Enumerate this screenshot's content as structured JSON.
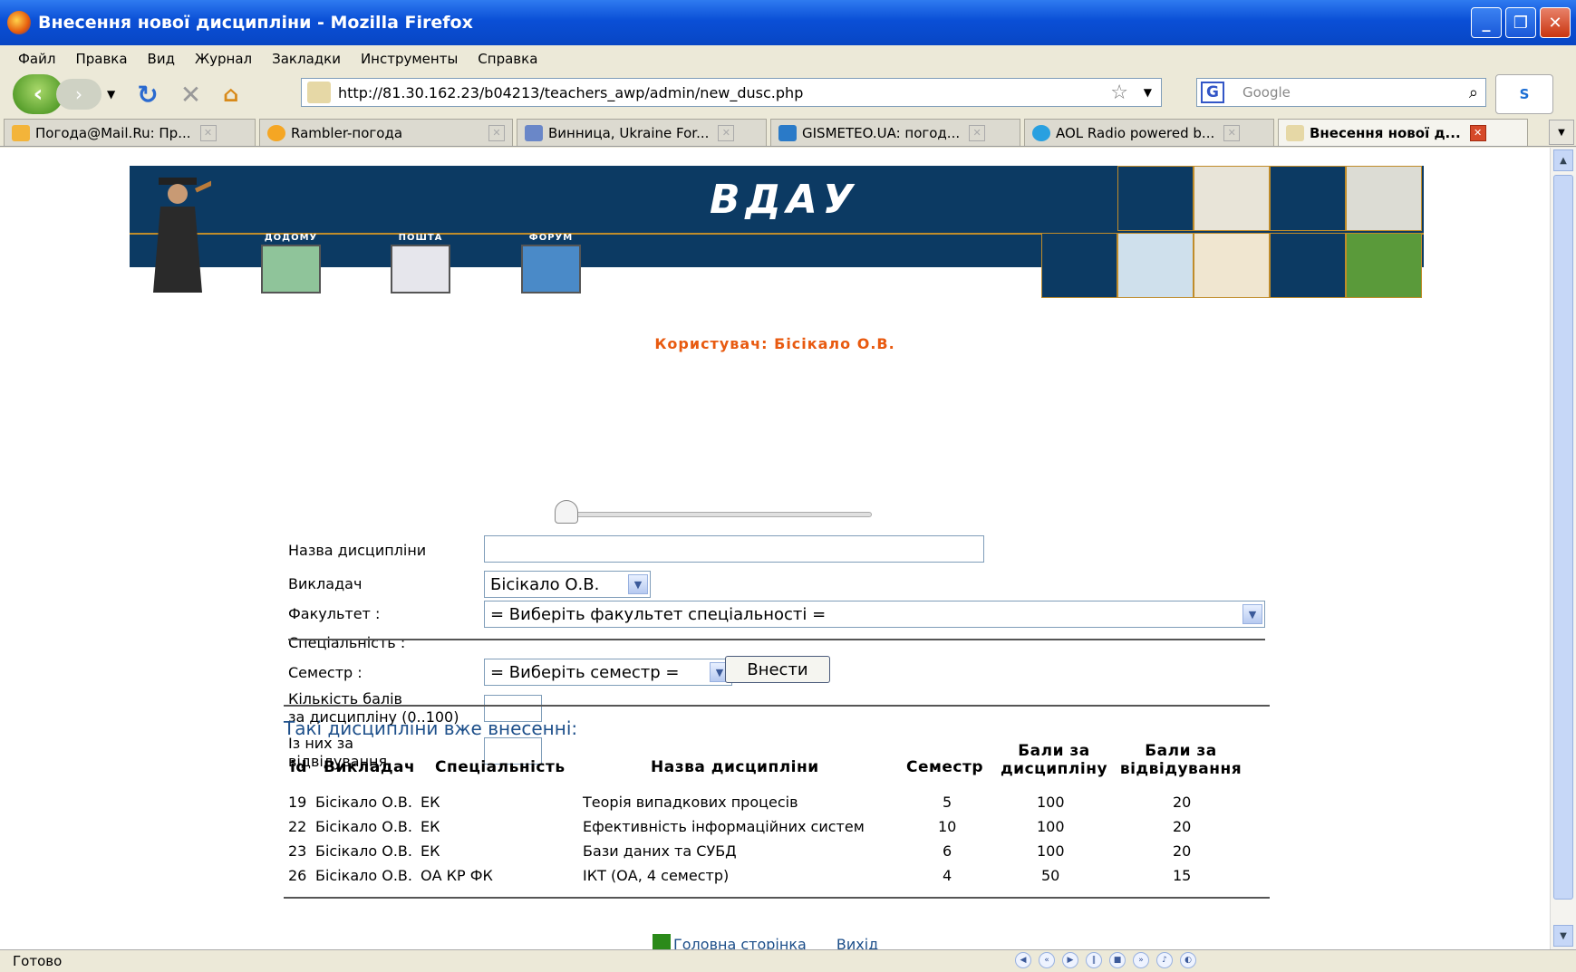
{
  "window": {
    "title": "Внесення нової дисципліни - Mozilla Firefox"
  },
  "menu": [
    "Файл",
    "Правка",
    "Вид",
    "Журнал",
    "Закладки",
    "Инструменты",
    "Справка"
  ],
  "nav": {
    "url": "http://81.30.162.23/b04213/teachers_awp/admin/new_dusc.php",
    "search_placeholder": "Google"
  },
  "tabs": [
    {
      "label": "Погода@Mail.Ru: Пр...",
      "active": false
    },
    {
      "label": "Rambler-погода",
      "active": false
    },
    {
      "label": "Винница, Ukraine For...",
      "active": false
    },
    {
      "label": "GISMETEO.UA: погод...",
      "active": false
    },
    {
      "label": "AOL Radio powered b...",
      "active": false
    },
    {
      "label": "Внесення нової д...",
      "active": true
    }
  ],
  "banner": {
    "brand": "ВДАУ",
    "nav": [
      "ДОДОМУ",
      "ПОШТА",
      "ФОРУМ"
    ]
  },
  "user_line": "Користувач: Бісікало О.В.",
  "form": {
    "labels": {
      "name": "Назва дисципліни",
      "teacher": "Викладач",
      "faculty": "Факультет :",
      "specialty": "Спеціальність :",
      "semester": "Семестр :",
      "points_line1": "Кількість балів",
      "points_line2": "за дисципліну (0..100)",
      "attendance_line1": "Із них за",
      "attendance_line2": "відвідування"
    },
    "values": {
      "name": "",
      "teacher": "Бісікало О.В.",
      "faculty": "= Виберіть факультет спеціальності =",
      "semester": "= Виберіть семестр =",
      "points": "",
      "attendance": ""
    },
    "slider_level": 0,
    "submit": "Внести"
  },
  "table": {
    "title": "Такі дисципліни вже внесенні:",
    "headers": {
      "id": "id",
      "teacher": "Викладач",
      "specialty": "Спеціальність",
      "name": "Назва дисципліни",
      "semester": "Семестр",
      "points_1": "Бали за",
      "points_2": "дисципліну",
      "attendance_1": "Бали за",
      "attendance_2": "відвідування"
    },
    "rows": [
      {
        "id": "19",
        "teacher": "Бісікало О.В.",
        "specialty": "ЕК",
        "name": "Теорія випадкових процесів",
        "semester": "5",
        "points": "100",
        "attendance": "20"
      },
      {
        "id": "22",
        "teacher": "Бісікало О.В.",
        "specialty": "ЕК",
        "name": "Ефективність інформаційних систем",
        "semester": "10",
        "points": "100",
        "attendance": "20"
      },
      {
        "id": "23",
        "teacher": "Бісікало О.В.",
        "specialty": "ЕК",
        "name": "Бази даних та СУБД",
        "semester": "6",
        "points": "100",
        "attendance": "20"
      },
      {
        "id": "26",
        "teacher": "Бісікало О.В.",
        "specialty": "ОА КР ФК",
        "name": "ІКТ (ОА, 4 семестр)",
        "semester": "4",
        "points": "50",
        "attendance": "15"
      }
    ]
  },
  "footer": {
    "home": "Головна сторінка",
    "exit": "Вихід"
  },
  "status": "Готово"
}
